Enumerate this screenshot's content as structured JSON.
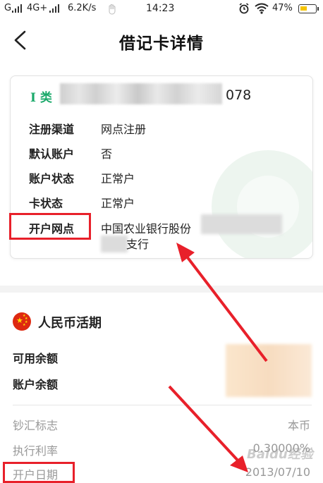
{
  "status_bar": {
    "signal_text": "G",
    "network_text": "4G+",
    "speed": "6.2K/s",
    "time": "14:23",
    "battery": "47%"
  },
  "header": {
    "title": "借记卡详情"
  },
  "card": {
    "class_label": "I 类",
    "number_tail": "078",
    "rows": [
      {
        "label": "注册渠道",
        "value": "网点注册"
      },
      {
        "label": "默认账户",
        "value": "否"
      },
      {
        "label": "账户状态",
        "value": "正常户"
      },
      {
        "label": "卡状态",
        "value": "正常户"
      },
      {
        "label": "开户网点",
        "value": "中国农业银行股份",
        "value2": "支行"
      }
    ]
  },
  "section": {
    "title": "人民币活期",
    "balances": [
      {
        "label": "可用余额"
      },
      {
        "label": "账户余额"
      }
    ],
    "info": [
      {
        "label": "钞汇标志",
        "value": "本币"
      },
      {
        "label": "执行利率",
        "value": "0.30000%"
      },
      {
        "label": "开户日期",
        "value": "2013/07/10"
      }
    ]
  },
  "watermark": "Baidu经验",
  "colors": {
    "accent_green": "#1aa96a",
    "highlight_red": "#e8202a",
    "flag_red": "#de2910"
  }
}
